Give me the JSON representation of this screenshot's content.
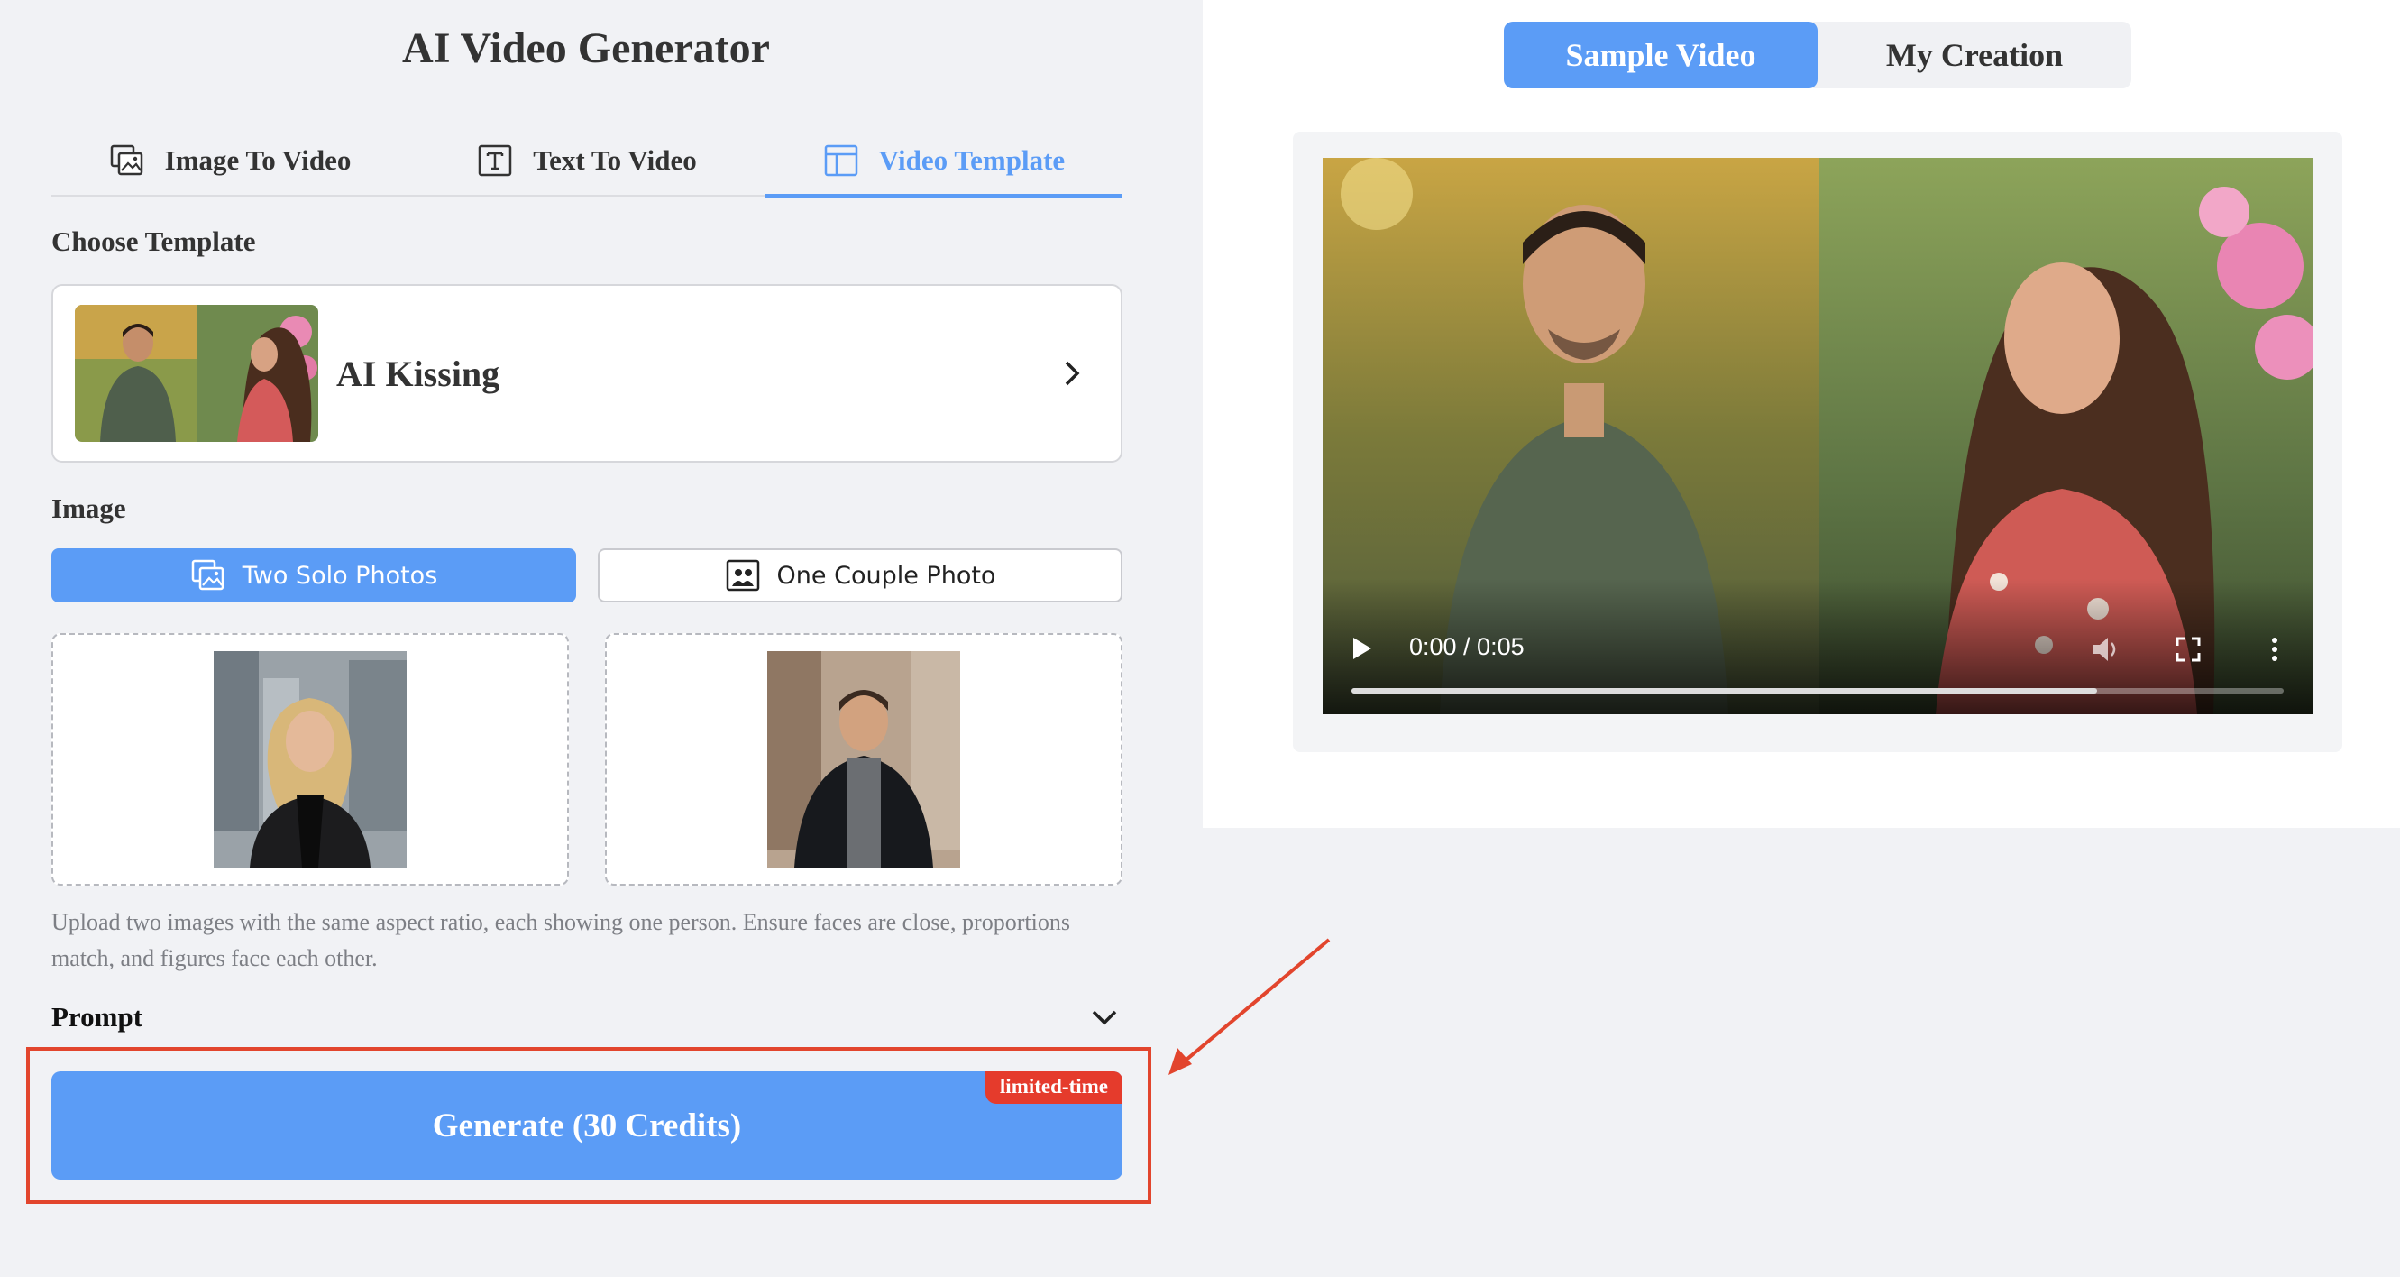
{
  "app": {
    "title": "AI Video Generator"
  },
  "tabs": [
    {
      "label": "Image To Video",
      "icon": "image-stack-icon",
      "active": false
    },
    {
      "label": "Text To Video",
      "icon": "text-box-icon",
      "active": false
    },
    {
      "label": "Video Template",
      "icon": "layout-icon",
      "active": true
    }
  ],
  "template": {
    "section_label": "Choose Template",
    "name": "AI Kissing"
  },
  "image": {
    "section_label": "Image",
    "modes": [
      {
        "label": "Two Solo Photos",
        "active": true
      },
      {
        "label": "One Couple Photo",
        "active": false
      }
    ],
    "hint": "Upload two images with the same aspect ratio, each showing one person. Ensure faces are close, proportions match, and figures face each other."
  },
  "prompt": {
    "label": "Prompt"
  },
  "generate": {
    "label": "Generate (30 Credits)",
    "badge": "limited-time"
  },
  "preview": {
    "tabs": [
      {
        "label": "Sample Video",
        "active": true
      },
      {
        "label": "My Creation",
        "active": false
      }
    ],
    "video": {
      "time": "0:00 / 0:05",
      "progress": 0.8
    }
  },
  "colors": {
    "accent": "#5b9cf6",
    "badge": "#e53b2c",
    "annotation": "#e2452d"
  }
}
